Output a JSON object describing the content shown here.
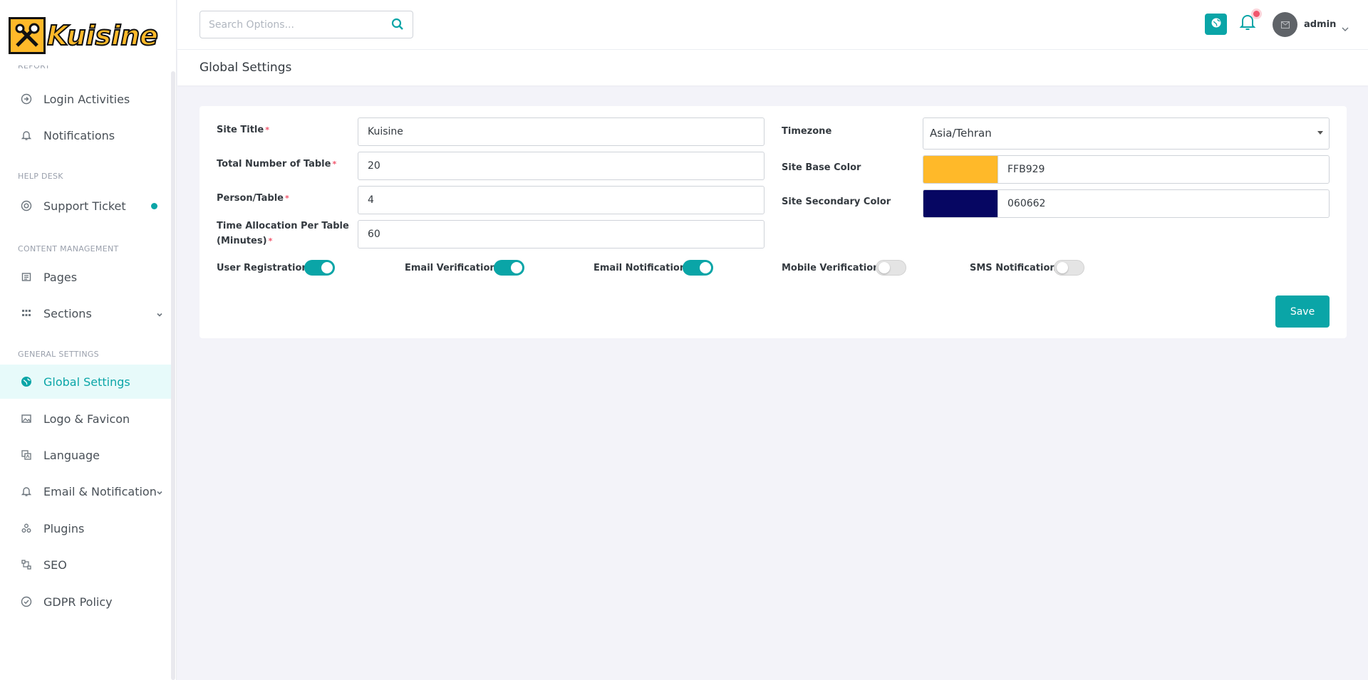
{
  "brand": {
    "name": "Kuisine"
  },
  "header": {
    "search_placeholder": "Search Options...",
    "user_name": "admin"
  },
  "sidebar": {
    "cut_section": "REPORT",
    "items": [
      {
        "label": "Login Activities",
        "icon": "login-icon"
      },
      {
        "label": "Notifications",
        "icon": "bell-icon"
      }
    ],
    "help_desk": {
      "title": "HELP DESK",
      "items": [
        {
          "label": "Support Ticket",
          "icon": "lifebuoy-icon"
        }
      ]
    },
    "content_management": {
      "title": "CONTENT MANAGEMENT",
      "items": [
        {
          "label": "Pages",
          "icon": "pages-icon"
        },
        {
          "label": "Sections",
          "icon": "grid-icon"
        }
      ]
    },
    "general_settings": {
      "title": "GENERAL SETTINGS",
      "items": [
        {
          "label": "Global Settings",
          "icon": "globe-icon",
          "active": true
        },
        {
          "label": "Logo & Favicon",
          "icon": "image-icon"
        },
        {
          "label": "Language",
          "icon": "language-icon"
        },
        {
          "label": "Email & Notification",
          "icon": "bell-icon"
        },
        {
          "label": "Plugins",
          "icon": "plugins-icon"
        },
        {
          "label": "SEO",
          "icon": "seo-icon"
        },
        {
          "label": "GDPR Policy",
          "icon": "check-circle-icon"
        }
      ]
    }
  },
  "page": {
    "title": "Global Settings"
  },
  "form": {
    "site_title": {
      "label": "Site Title",
      "value": "Kuisine"
    },
    "total_tables": {
      "label": "Total Number of Table",
      "value": "20"
    },
    "person_table": {
      "label": "Person/Table",
      "value": "4"
    },
    "time_allocation": {
      "label_line1": "Time Allocation Per Table",
      "label_line2": "(Minutes)",
      "value": "60"
    },
    "timezone": {
      "label": "Timezone",
      "value": "Asia/Tehran"
    },
    "base_color": {
      "label": "Site Base Color",
      "value": "FFB929",
      "swatch": "#FFB929"
    },
    "secondary_color": {
      "label": "Site Secondary Color",
      "value": "060662",
      "swatch": "#060662"
    },
    "required_mark": "*",
    "toggles": [
      {
        "label": "User Registration",
        "on": true
      },
      {
        "label": "Email Verification",
        "on": true
      },
      {
        "label": "Email Notification",
        "on": true
      },
      {
        "label": "Mobile Verification",
        "on": false
      },
      {
        "label": "SMS Notification",
        "on": false
      }
    ],
    "save_label": "Save"
  },
  "colors": {
    "accent": "#0AA5A7",
    "brand": "#FFB929",
    "alert": "#F1556C"
  }
}
